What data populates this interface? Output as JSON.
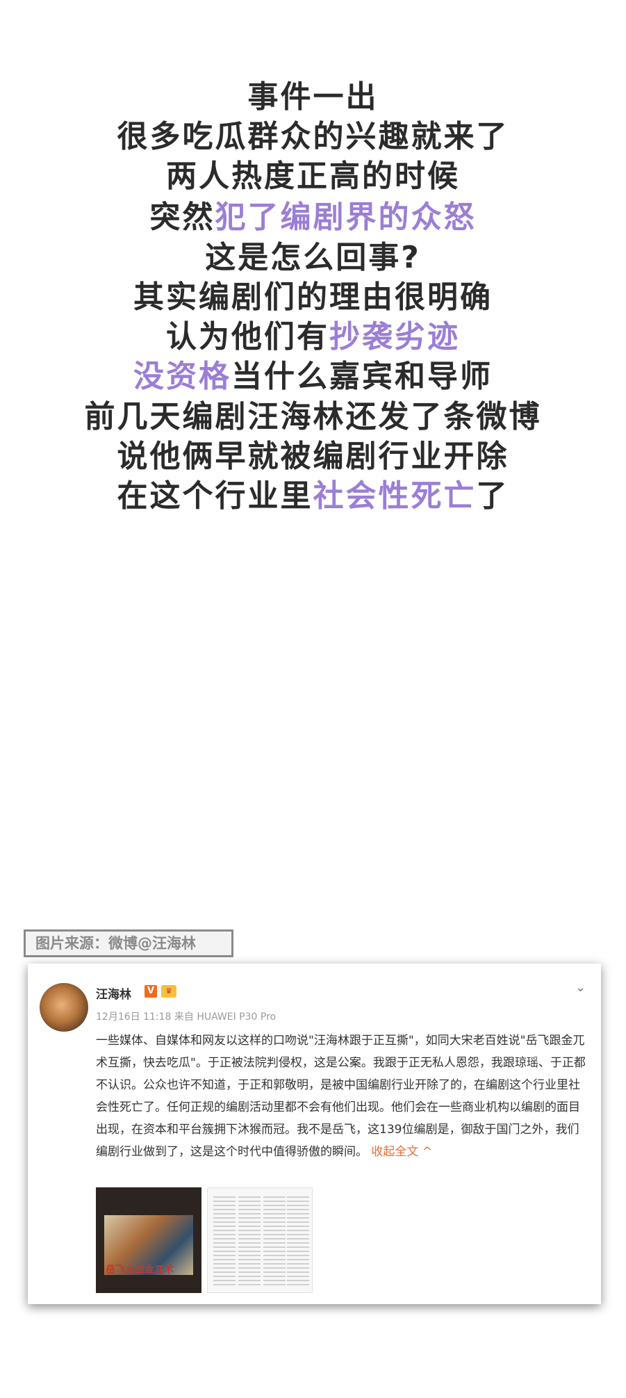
{
  "lines": [
    [
      {
        "t": "事件一出"
      }
    ],
    [
      {
        "t": "很多吃瓜群众的兴趣就来了"
      }
    ],
    [
      {
        "t": "两人热度正高的时候"
      }
    ],
    [
      {
        "t": "突然"
      },
      {
        "t": "犯了编剧界的众怒",
        "hl": true
      }
    ],
    [
      {
        "t": "这是怎么回事?"
      }
    ],
    [
      {
        "t": "其实编剧们的理由很明确"
      }
    ],
    [
      {
        "t": "认为他们有"
      },
      {
        "t": "抄袭劣迹",
        "hl": true
      }
    ],
    [
      {
        "t": "没资格",
        "hl": true
      },
      {
        "t": "当什么嘉宾和导师"
      }
    ],
    [
      {
        "t": "前几天编剧汪海林还发了条微博"
      }
    ],
    [
      {
        "t": "说他俩早就被编剧行业开除"
      }
    ],
    [
      {
        "t": "在这个行业里"
      },
      {
        "t": "社会性死亡",
        "hl": true
      },
      {
        "t": "了"
      }
    ]
  ],
  "highlight_color": "#9b7ed6",
  "source_tag": "图片来源：微博@汪海林",
  "post": {
    "username": "汪海林",
    "verified_badge": "V",
    "crown_badge": "♛",
    "meta": "12月16日 11:18 来自 HUAWEI P30 Pro",
    "text": "一些媒体、自媒体和网友以这样的口吻说\"汪海林跟于正互撕\"，如同大宋老百姓说\"岳飞跟金兀术互撕，快去吃瓜\"。于正被法院判侵权，这是公案。我跟于正无私人恩怨，我跟琼瑶、于正都不认识。公众也许不知道，于正和郭敬明，是被中国编剧行业开除了的，在编剧这个行业里社会性死亡了。任何正规的编剧活动里都不会有他们出现。他们会在一些商业机构以编剧的面目出现，在资本和平台簇拥下沐猴而冠。我不是岳飞，这139位编剧是，御敌于国门之外，我们编剧行业做到了，这是这个时代中值得骄傲的瞬间。",
    "collapse_label": "收起全文 ^",
    "image1_caption": "岳飞大战金兀术",
    "chevron_icon": "chevron-down-icon"
  }
}
